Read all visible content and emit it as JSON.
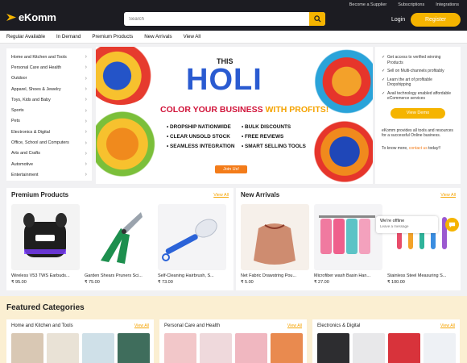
{
  "header": {
    "brand": "eKomm",
    "top_links": [
      "Become a Supplier",
      "Subscriptions",
      "Integrations"
    ],
    "search_placeholder": "Search",
    "login": "Login",
    "register": "Register"
  },
  "nav": [
    "Regular Available",
    "In Demand",
    "Premium Products",
    "New Arrivals",
    "View All"
  ],
  "sidebar": [
    "Home and Kitchen and Tools",
    "Personal Care and Health",
    "Outdoor",
    "Apparel, Shoes & Jewelry",
    "Toys, Kids and Baby",
    "Sports",
    "Pets",
    "Electronics & Digital",
    "Office, School and Computers",
    "Arts and Crafts",
    "Automotive",
    "Entertainment"
  ],
  "banner": {
    "this": "THIS",
    "holi": "HOLI",
    "sub_a": "COLOR YOUR BUSINESS ",
    "sub_b": "WITH PROFITS!",
    "points": [
      "• DROPSHIP NATIONWIDE",
      "• BULK DISCOUNTS",
      "• CLEAR UNSOLD STOCK",
      "• FREE REVIEWS",
      "• SEAMLESS INTEGRATION",
      "• SMART SELLING TOOLS"
    ],
    "join": "Join Us!"
  },
  "promo": {
    "items": [
      "Get access to verified winning Products",
      "Sell on Multi-channels profitably",
      "Learn the art of profitable Dropshipping",
      "Avail technology enabled affordable eCommerce services"
    ],
    "demo": "View Demo",
    "text": "eKomm provides all tools and resources for a successful Online business.",
    "know_pre": "To know more, ",
    "know_link": "contact us",
    "know_post": " today!!"
  },
  "premium": {
    "title": "Premium Products",
    "view_all": "View All",
    "products": [
      {
        "name": "Wireless V53 TWS Earbuds...",
        "price": "₹ 95.00"
      },
      {
        "name": "Garden Shears Pruners Sci...",
        "price": "₹ 75.00"
      },
      {
        "name": "Self-Cleaning Hairbrush, S...",
        "price": "₹ 73.00"
      }
    ]
  },
  "arrivals": {
    "title": "New Arrivals",
    "view_all": "View All",
    "products": [
      {
        "name": "Net Fabric Drawstring Pou...",
        "price": "₹ 5.00"
      },
      {
        "name": "Microfiber wash Basin Han...",
        "price": "₹ 27.00"
      },
      {
        "name": "Stainless Steel Measuring S...",
        "price": "₹ 100.00"
      }
    ]
  },
  "chat": {
    "title": "We're offline",
    "sub": "Leave a message"
  },
  "featured": {
    "title": "Featured Categories",
    "cards": [
      {
        "title": "Home and Kitchen and Tools",
        "view_all": "View All"
      },
      {
        "title": "Personal Care and Health",
        "view_all": "View All"
      },
      {
        "title": "Electronics & Digital",
        "view_all": "View All"
      }
    ]
  }
}
